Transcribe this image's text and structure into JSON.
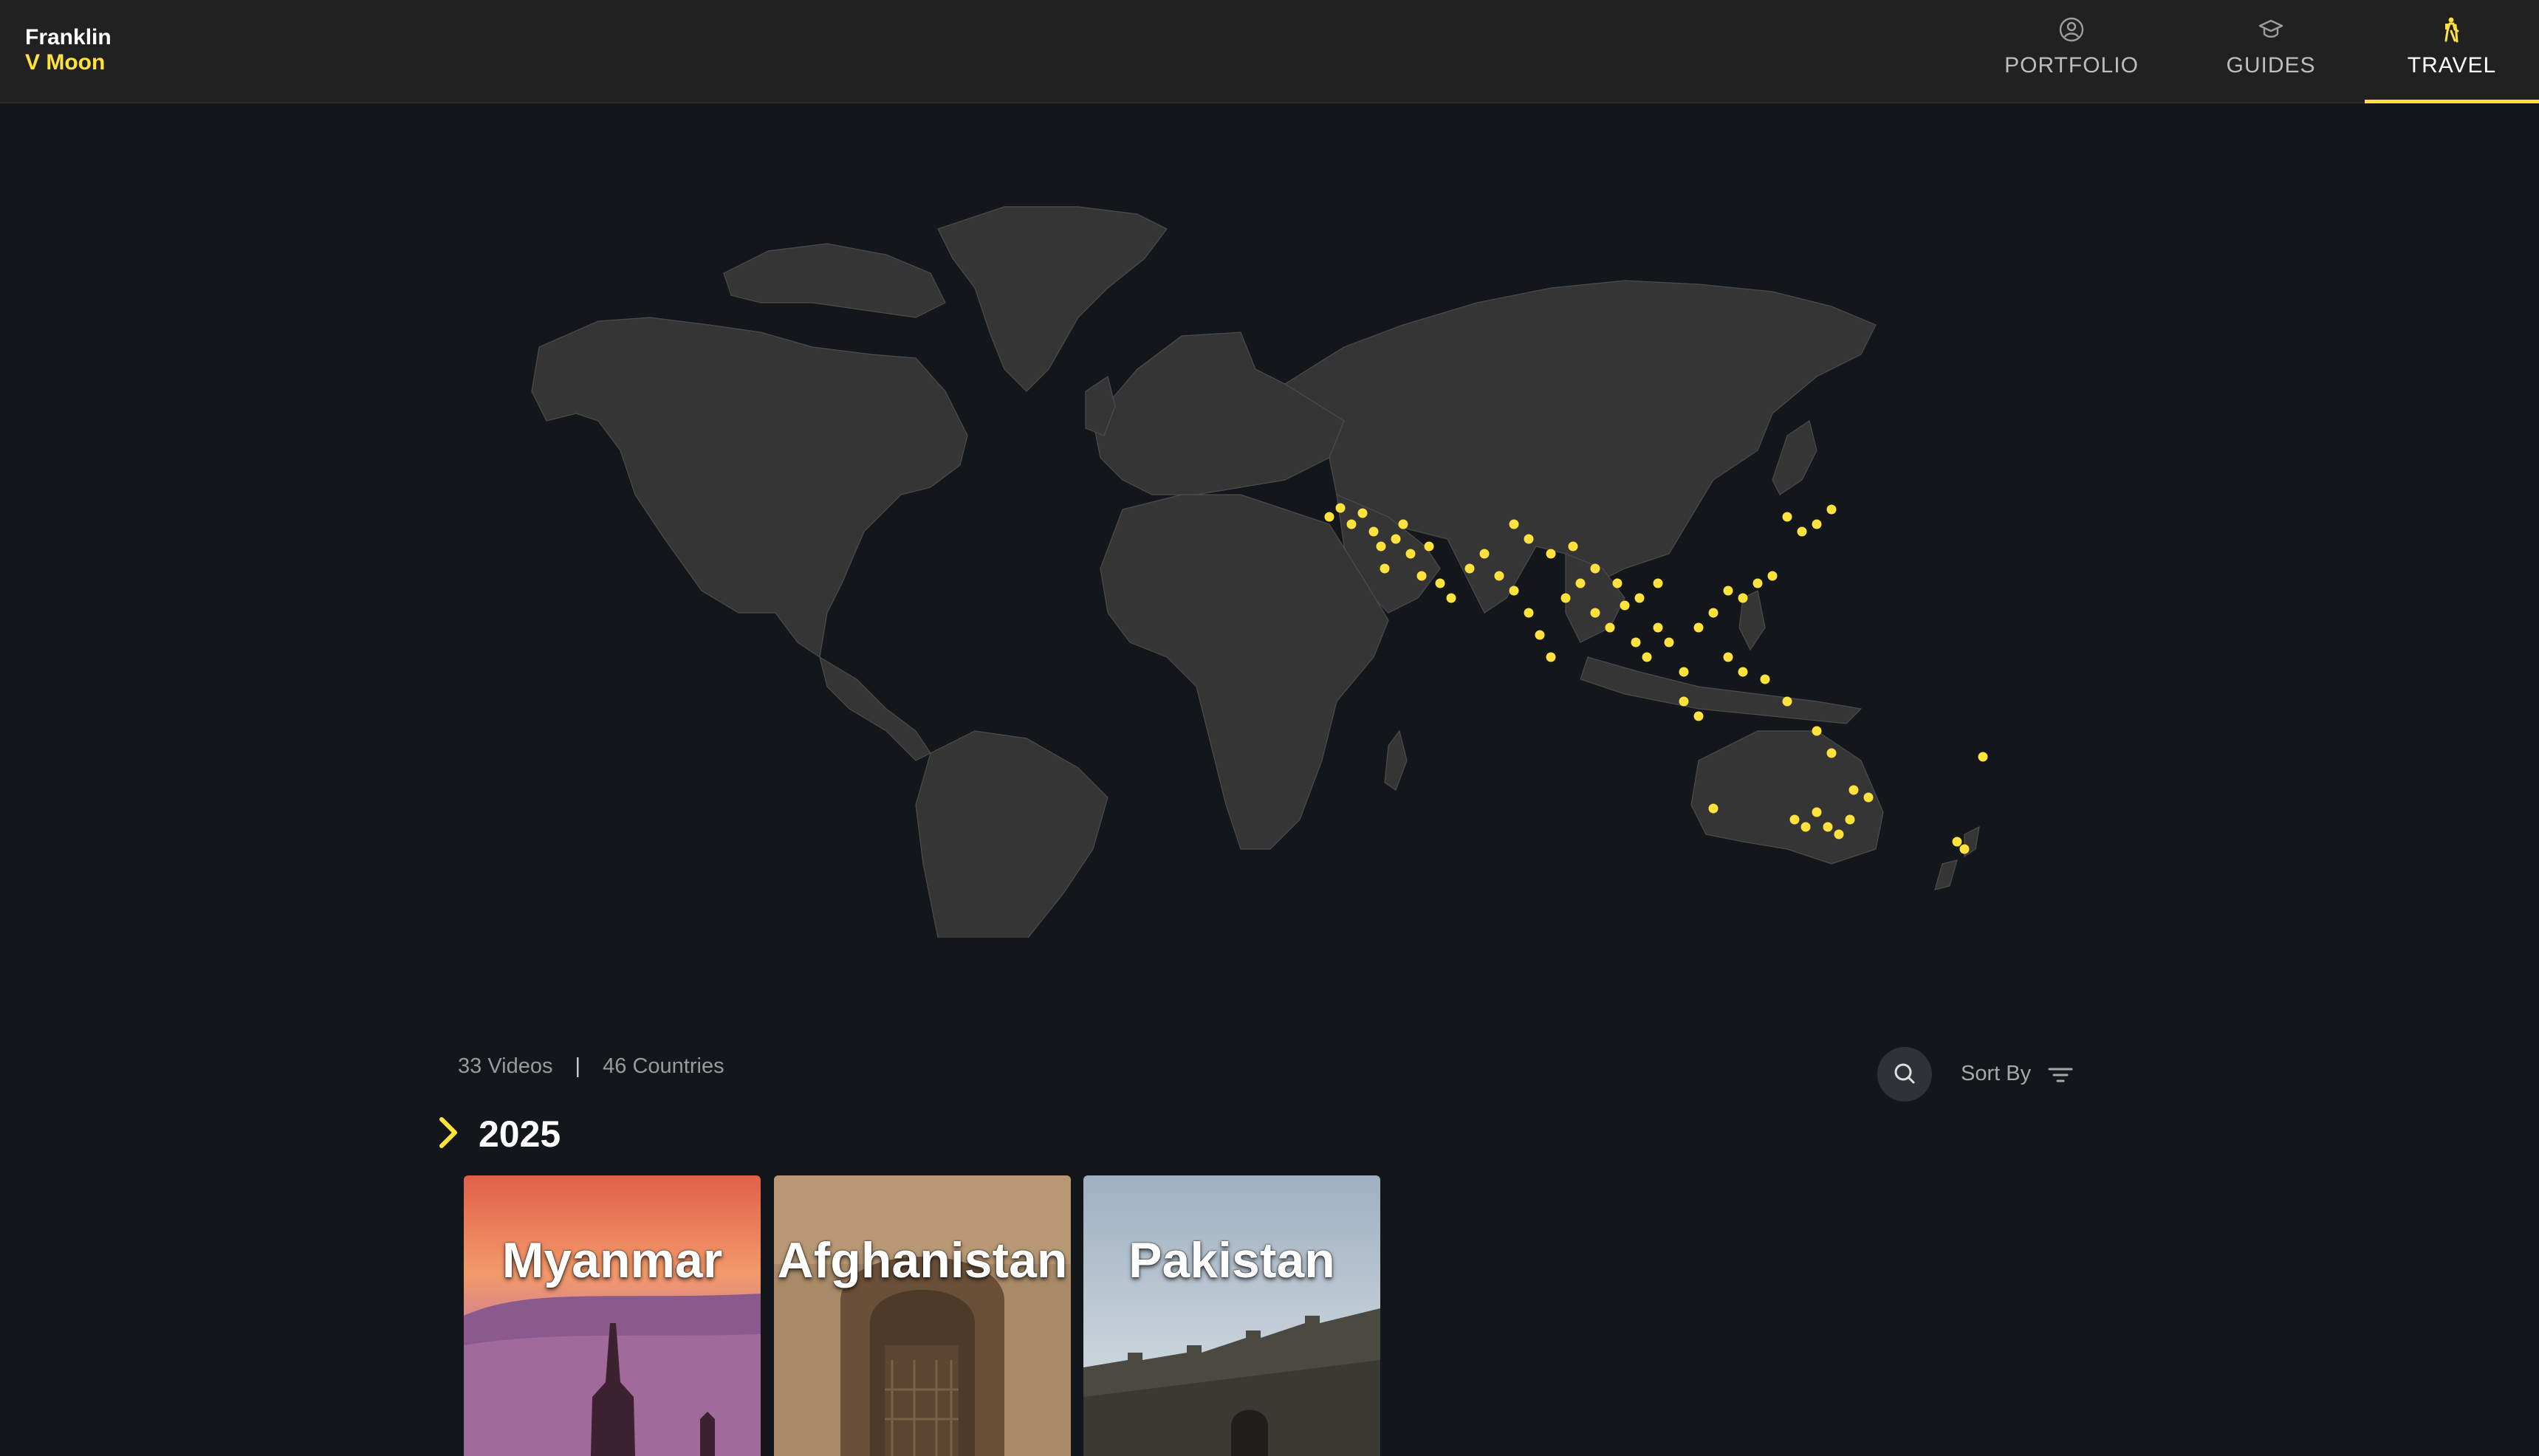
{
  "header": {
    "logo": {
      "line1": "Franklin",
      "line2": "V Moon"
    },
    "nav": [
      {
        "label": "PORTFOLIO",
        "icon": "user-circle-icon"
      },
      {
        "label": "GUIDES",
        "icon": "graduation-cap-icon"
      },
      {
        "label": "TRAVEL",
        "icon": "hiker-icon",
        "active": true
      }
    ]
  },
  "colors": {
    "accent": "#ffe23d",
    "background": "#13161a",
    "header": "#212121",
    "land": "#3a3a3a"
  },
  "stats": {
    "videos": "33 Videos",
    "separator": "|",
    "countries": "46 Countries"
  },
  "toolbar": {
    "search_icon": "search-icon",
    "sort_label": "Sort By",
    "sort_icon": "filter-lines-icon"
  },
  "year_group": {
    "year": "2025",
    "chevron_icon": "chevron-right-icon"
  },
  "cards": [
    {
      "title": "Myanmar"
    },
    {
      "title": "Afghanistan"
    },
    {
      "title": "Pakistan"
    }
  ]
}
